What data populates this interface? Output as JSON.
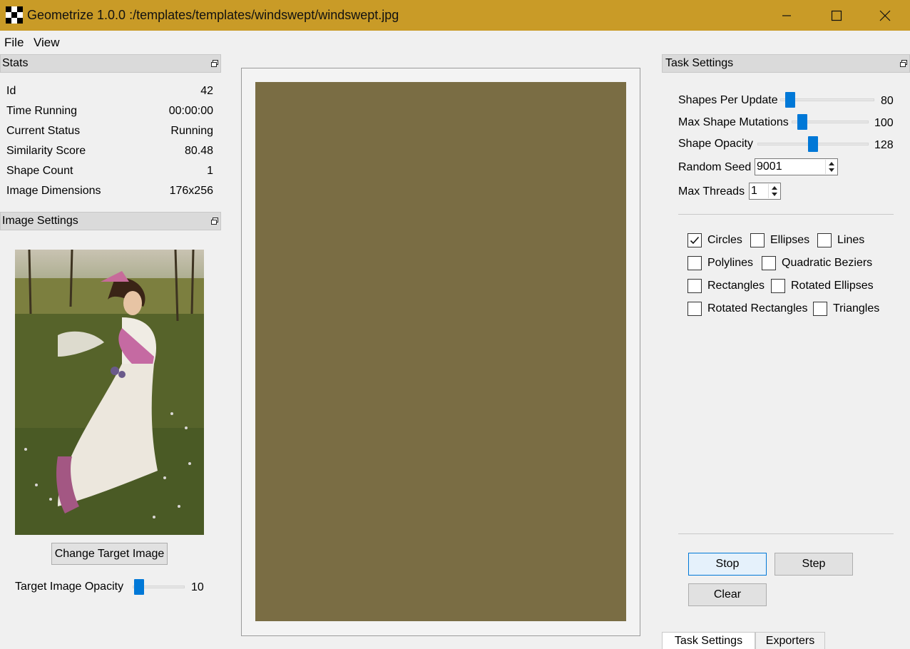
{
  "window": {
    "title": "Geometrize 1.0.0 :/templates/templates/windswept/windswept.jpg"
  },
  "menu": {
    "file": "File",
    "view": "View"
  },
  "stats": {
    "header": "Stats",
    "rows": [
      {
        "label": "Id",
        "value": "42"
      },
      {
        "label": "Time Running",
        "value": "00:00:00"
      },
      {
        "label": "Current Status",
        "value": "Running"
      },
      {
        "label": "Similarity Score",
        "value": "80.48"
      },
      {
        "label": "Shape Count",
        "value": "1"
      },
      {
        "label": "Image Dimensions",
        "value": "176x256"
      }
    ]
  },
  "image_settings": {
    "header": "Image Settings",
    "change_button": "Change Target Image",
    "opacity_label": "Target Image Opacity",
    "opacity_value": "10",
    "opacity_fraction": 0.04
  },
  "canvas": {
    "fill_color": "#7a6d44"
  },
  "task_settings": {
    "header": "Task Settings",
    "shapes_per_update": {
      "label": "Shapes Per Update",
      "value": "80",
      "fraction": 0.06
    },
    "max_shape_mutations": {
      "label": "Max Shape Mutations",
      "value": "100",
      "fraction": 0.08
    },
    "shape_opacity": {
      "label": "Shape Opacity",
      "value": "128",
      "fraction": 0.5
    },
    "random_seed": {
      "label": "Random Seed",
      "value": "9001"
    },
    "max_threads": {
      "label": "Max Threads",
      "value": "1"
    },
    "shapes": [
      {
        "label": "Circles",
        "checked": true
      },
      {
        "label": "Ellipses",
        "checked": false
      },
      {
        "label": "Lines",
        "checked": false
      },
      {
        "label": "Polylines",
        "checked": false
      },
      {
        "label": "Quadratic Beziers",
        "checked": false
      },
      {
        "label": "Rectangles",
        "checked": false
      },
      {
        "label": "Rotated Ellipses",
        "checked": false
      },
      {
        "label": "Rotated Rectangles",
        "checked": false
      },
      {
        "label": "Triangles",
        "checked": false
      }
    ],
    "stop_button": "Stop",
    "step_button": "Step",
    "clear_button": "Clear"
  },
  "tabs": [
    {
      "label": "Task Settings",
      "active": true
    },
    {
      "label": "Exporters",
      "active": false
    }
  ],
  "colors": {
    "titlebar": "#c99b27",
    "accent": "#0078d7"
  }
}
